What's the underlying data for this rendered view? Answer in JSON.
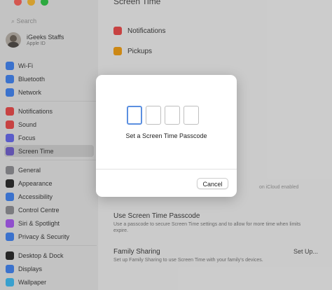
{
  "sidebar": {
    "search_placeholder": "Search",
    "user": {
      "name": "iGeeks Staffs",
      "subtitle": "Apple ID"
    },
    "items": [
      {
        "label": "Wi-Fi",
        "color": "#3b82f6"
      },
      {
        "label": "Bluetooth",
        "color": "#3b82f6"
      },
      {
        "label": "Network",
        "color": "#3b82f6"
      },
      {
        "label": "Notifications",
        "color": "#ef4444"
      },
      {
        "label": "Sound",
        "color": "#ef4444"
      },
      {
        "label": "Focus",
        "color": "#6366f1"
      },
      {
        "label": "Screen Time",
        "color": "#6d5bd0"
      },
      {
        "label": "General",
        "color": "#8e8e93"
      },
      {
        "label": "Appearance",
        "color": "#222222"
      },
      {
        "label": "Accessibility",
        "color": "#3b82f6"
      },
      {
        "label": "Control Centre",
        "color": "#8e8e93"
      },
      {
        "label": "Siri & Spotlight",
        "color": "#a855f7"
      },
      {
        "label": "Privacy & Security",
        "color": "#3b82f6"
      },
      {
        "label": "Desktop & Dock",
        "color": "#222222"
      },
      {
        "label": "Displays",
        "color": "#3b82f6"
      },
      {
        "label": "Wallpaper",
        "color": "#38bdf8"
      }
    ]
  },
  "main": {
    "heading": "Screen Time",
    "rows": [
      {
        "label": "Notifications",
        "color": "#ef4444"
      },
      {
        "label": "Pickups",
        "color": "#f59e0b"
      }
    ],
    "passcode_option": {
      "title": "Use Screen Time Passcode",
      "desc": "Use a passcode to secure Screen Time settings and to allow for more time when limits expire."
    },
    "family_sharing": {
      "title": "Family Sharing",
      "desc": "Set up Family Sharing to use Screen Time with your family's devices.",
      "setup_label": "Set Up..."
    },
    "bg_fragment": "on iCloud enabled"
  },
  "modal": {
    "title": "Set a Screen Time Passcode",
    "cancel_label": "Cancel",
    "digit_count": 4
  }
}
